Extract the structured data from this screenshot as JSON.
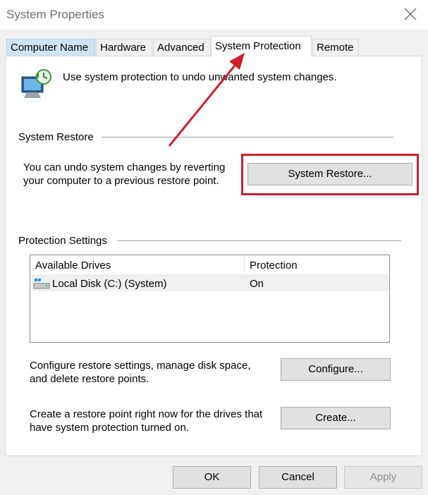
{
  "window": {
    "title": "System Properties",
    "close_icon": "close-icon"
  },
  "tabs": [
    {
      "label": "Computer Name"
    },
    {
      "label": "Hardware"
    },
    {
      "label": "Advanced"
    },
    {
      "label": "System Protection"
    },
    {
      "label": "Remote"
    }
  ],
  "intro": {
    "icon": "system-protection-icon",
    "text": "Use system protection to undo unwanted system changes."
  },
  "system_restore": {
    "heading": "System Restore",
    "description_line1": "You can undo system changes by reverting",
    "description_line2": "your computer to a previous restore point.",
    "button_label": "System Restore..."
  },
  "protection_settings": {
    "heading": "Protection Settings",
    "columns": [
      "Available Drives",
      "Protection"
    ],
    "rows": [
      {
        "drive": "Local Disk (C:) (System)",
        "protection": "On",
        "icon": "drive-icon"
      }
    ]
  },
  "configure": {
    "description_line1": "Configure restore settings, manage disk space,",
    "description_line2": "and delete restore points.",
    "button_label": "Configure..."
  },
  "create": {
    "description_line1": "Create a restore point right now for the drives that",
    "description_line2": "have system protection turned on.",
    "button_label": "Create..."
  },
  "footer": {
    "ok_label": "OK",
    "cancel_label": "Cancel",
    "apply_label": "Apply"
  },
  "annotations": {
    "arrow_color": "#d01e2a",
    "highlight_color": "#d01e2a"
  }
}
